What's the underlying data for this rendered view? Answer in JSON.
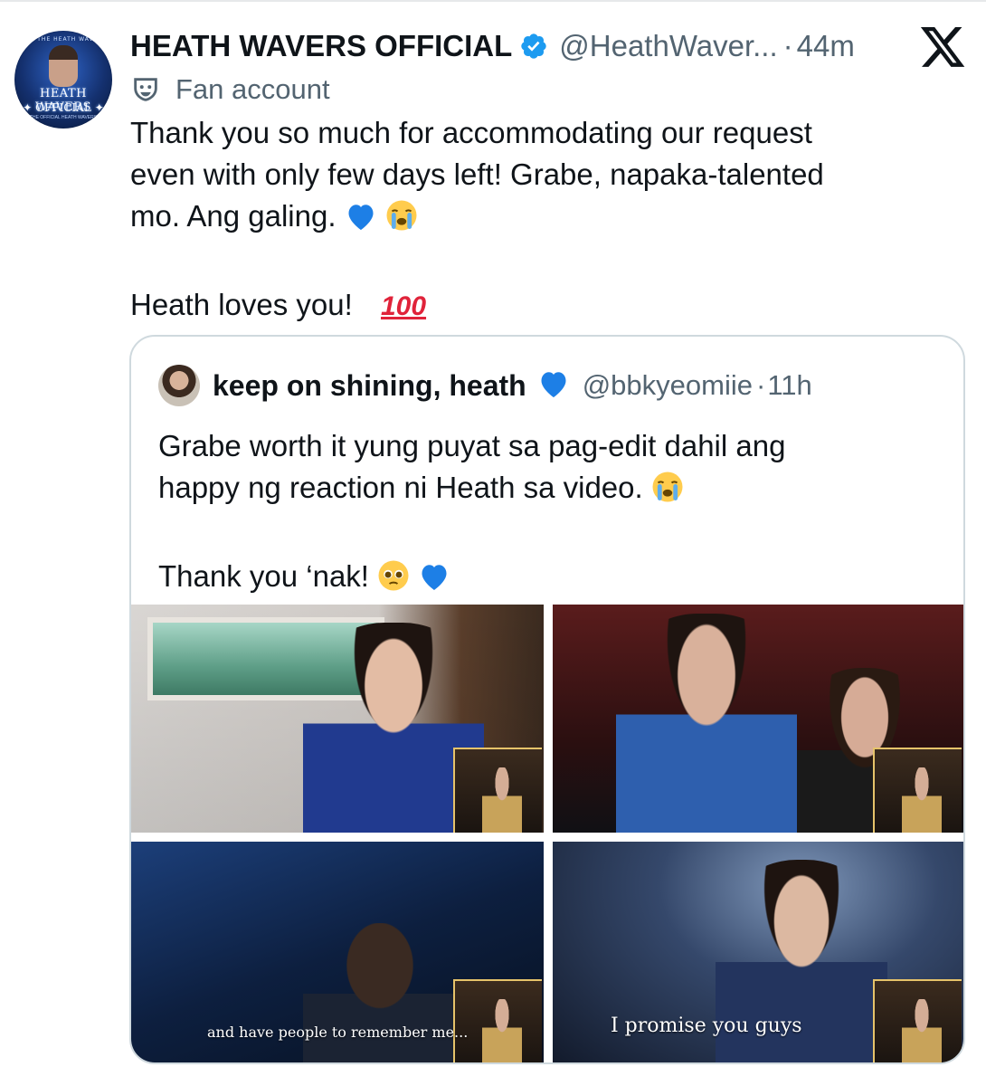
{
  "tweet": {
    "author": {
      "display_name": "HEATH WAVERS OFFICIAL",
      "handle": "@HeathWaver...",
      "verified": true,
      "avatar_text": {
        "ring": "JOIN THE HEATH WAVERS",
        "line1": "HEATH WAVERS",
        "line2": "✦ OFFICIAL ✦",
        "line3": "THE OFFICIAL HEATH WAVERS"
      }
    },
    "separator": "·",
    "timestamp": "44m",
    "label": "Fan account",
    "text_lines": [
      "Thank you so much for accommodating our request",
      "even with only few days left! Grabe, napaka-talented",
      "mo. Ang galing."
    ],
    "text_line3_emojis": [
      "💙",
      "😭"
    ],
    "text_line4": "Heath loves you!",
    "text_line4_emoji": "💯"
  },
  "quoted": {
    "display_name": "keep on shining, heath",
    "name_emoji": "💙",
    "handle": "@bbkyeomiie",
    "separator": "·",
    "timestamp": "11h",
    "text_lines": [
      "Grabe worth it yung puyat sa pag-edit dahil ang",
      "happy ng reaction ni Heath sa video."
    ],
    "text_line2_emoji": "😭",
    "text_line3": "Thank you ‘nak!",
    "text_line3_emojis": [
      "🥺",
      "💙"
    ],
    "media_captions": [
      "and have people to remember me...",
      "I promise you guys"
    ]
  },
  "colors": {
    "primary_text": "#0f1419",
    "secondary_text": "#536471",
    "verified_blue": "#1d9bf0",
    "card_border": "#cfd9de"
  },
  "icons": {
    "verified": "verified-badge-icon",
    "x_logo": "x-logo-icon",
    "label": "theater-mask-icon"
  }
}
